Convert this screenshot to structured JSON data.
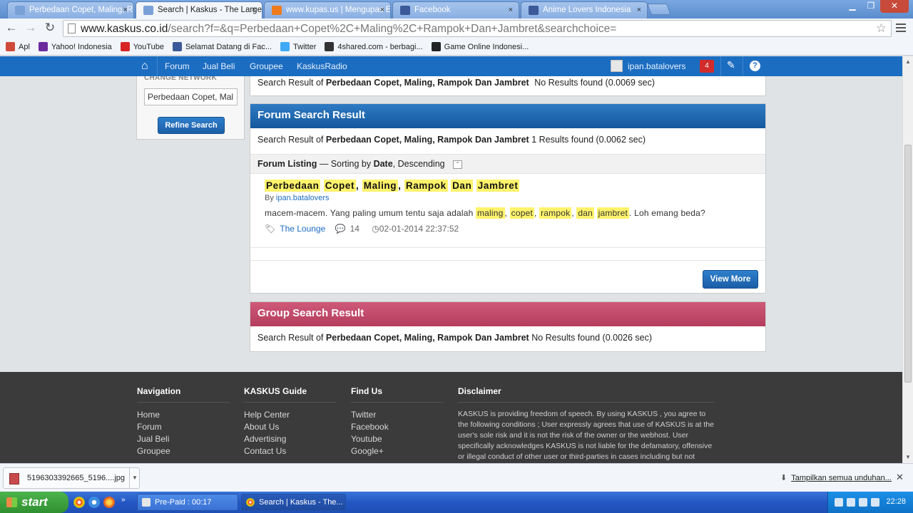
{
  "browser": {
    "tabs": [
      {
        "label": "Perbedaan Copet, Maling, R",
        "favicon_color": "#7aa0d8"
      },
      {
        "label": "Search | Kaskus - The Larges",
        "favicon_color": "#7aa0d8"
      },
      {
        "label": "www.kupas.us | Mengupas E",
        "favicon_color": "#f07b1d"
      },
      {
        "label": "Facebook",
        "favicon_color": "#3b5998"
      },
      {
        "label": "Anime Lovers Indonesia",
        "favicon_color": "#3b5998"
      }
    ],
    "tab_close_glyph": "×",
    "url_host": "www.kaskus.co.id",
    "url_rest": "/search?f=&q=Perbedaan+Copet%2C+Maling%2C+Rampok+Dan+Jambret&searchchoice=",
    "bookmarks": [
      {
        "label": "Apl",
        "icon": "apps-grid-icon",
        "color": "#d04a3a"
      },
      {
        "label": "Yahoo! Indonesia",
        "icon": "yahoo-icon",
        "color": "#6b2b9e"
      },
      {
        "label": "YouTube",
        "icon": "youtube-icon",
        "color": "#d62424"
      },
      {
        "label": "Selamat Datang di Fac...",
        "icon": "facebook-icon",
        "color": "#3b5998"
      },
      {
        "label": "Twitter",
        "icon": "twitter-icon",
        "color": "#3fa9f5"
      },
      {
        "label": "4shared.com - berbagi...",
        "icon": "4shared-icon",
        "color": "#333333"
      },
      {
        "label": "Game Online Indonesi...",
        "icon": "game-icon",
        "color": "#222222"
      }
    ]
  },
  "kaskus": {
    "nav": [
      "Forum",
      "Jual Beli",
      "Groupee",
      "KaskusRadio"
    ],
    "username": "ipan.batalovers",
    "notifications": "4",
    "sidebar": {
      "label": "CHANGE NETWORK",
      "search_value": "Perbedaan Copet, Mal",
      "refine_button": "Refine Search"
    },
    "query": "Perbedaan Copet, Maling, Rampok Dan Jambret",
    "top_result": {
      "prefix": "Search Result of",
      "suffix": "No Results found (0.0069 sec)"
    },
    "forum": {
      "header": "Forum Search Result",
      "prefix": "Search Result of",
      "suffix": "1 Results found (0.0062 sec)",
      "listing_label": "Forum Listing",
      "listing_sort_prefix": "— Sorting by",
      "sort_field": "Date",
      "sort_order": ", Descending",
      "result": {
        "title_words": [
          "Perbedaan",
          "Copet",
          ",",
          "Maling",
          ",",
          "Rampok",
          "Dan",
          "Jambret"
        ],
        "by_label": "By",
        "author": "ipan.batalovers",
        "snippet_before": "macem-macem. Yang paling umum tentu saja adalah",
        "snippet_words": [
          "maling",
          ",",
          "copet",
          ",",
          "rampok",
          ",",
          "dan",
          "jambret"
        ],
        "snippet_after": ". Loh emang beda?",
        "category": "The Lounge",
        "replies": "14",
        "date": "02-01-2014 22:37:52"
      },
      "view_more": "View More"
    },
    "group": {
      "header": "Group Search Result",
      "prefix": "Search Result of",
      "suffix": "No Results found (0.0026 sec)"
    },
    "footer": {
      "navigation": {
        "title": "Navigation",
        "links": [
          "Home",
          "Forum",
          "Jual Beli",
          "Groupee"
        ]
      },
      "guide": {
        "title": "KASKUS Guide",
        "links": [
          "Help Center",
          "About Us",
          "Advertising",
          "Contact Us"
        ]
      },
      "find_us": {
        "title": "Find Us",
        "links": [
          "Twitter",
          "Facebook",
          "Youtube",
          "Google+"
        ]
      },
      "disclaimer": {
        "title": "Disclaimer",
        "text": "KASKUS is providing freedom of speech. By using KASKUS , you agree to the following conditions ; User expressly agrees that use of KASKUS is at the user's sole risk and it is not the risk of the owner or the webhost. User specifically acknowledges KASKUS is not liable for the defamatory, offensive or illegal conduct of other user or third-parties in cases including but not limited"
      }
    }
  },
  "download_shelf": {
    "file": "5196303392665_5196....jpg",
    "show_all": "Tampilkan semua unduhan..."
  },
  "taskbar": {
    "start": "start",
    "buttons": [
      "Pre-Paid : 00:17",
      "Search | Kaskus - The..."
    ],
    "clock": "22:28"
  }
}
